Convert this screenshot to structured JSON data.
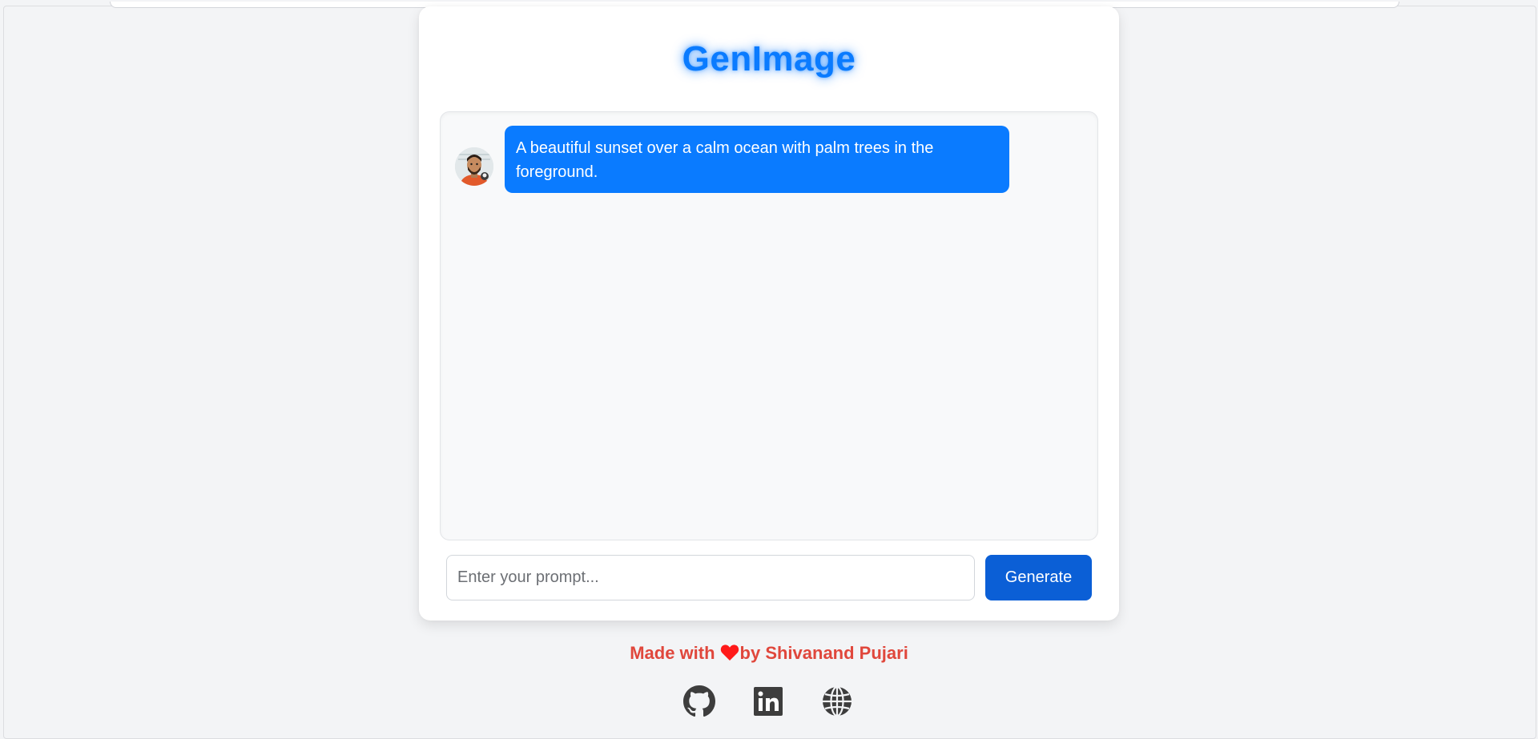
{
  "app": {
    "title": "GenImage"
  },
  "chat": {
    "messages": [
      {
        "role": "user",
        "avatar": "user-avatar",
        "text": "A beautiful sunset over a calm ocean with palm trees in the foreground."
      }
    ]
  },
  "composer": {
    "placeholder": "Enter your prompt...",
    "value": "",
    "button_label": "Generate"
  },
  "footer": {
    "made_with": "Made with",
    "by_text": "by Shivanand Pujari",
    "heart_icon": "heart-icon",
    "socials": [
      {
        "icon": "github-icon"
      },
      {
        "icon": "linkedin-icon"
      },
      {
        "icon": "globe-icon"
      }
    ]
  },
  "colors": {
    "accent": "#0a7bff",
    "button": "#0b5fd6",
    "footer_text": "#e0473c",
    "background": "#f3f4f6"
  }
}
